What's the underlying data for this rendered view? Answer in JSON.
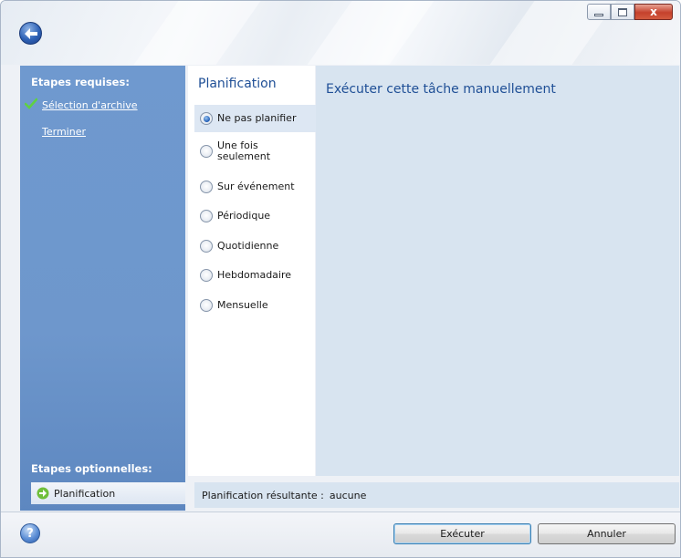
{
  "window": {
    "controls": {
      "close_label": "x"
    }
  },
  "sidebar": {
    "required_heading": "Etapes requises:",
    "required_items": [
      {
        "label": "Sélection d'archive",
        "done": true
      },
      {
        "label": "Terminer",
        "done": false
      }
    ],
    "optional_heading": "Etapes optionnelles:",
    "optional_items": [
      {
        "label": "Planification",
        "current": true
      }
    ]
  },
  "schedule": {
    "title": "Planification",
    "options": [
      {
        "label": "Ne pas planifier",
        "selected": true
      },
      {
        "label": "Une fois seulement",
        "label_line1": "Une fois",
        "label_line2": "seulement",
        "selected": false
      },
      {
        "label": "Sur événement",
        "selected": false
      },
      {
        "label": "Périodique",
        "selected": false
      },
      {
        "label": "Quotidienne",
        "selected": false
      },
      {
        "label": "Hebdomadaire",
        "selected": false
      },
      {
        "label": "Mensuelle",
        "selected": false
      }
    ]
  },
  "detail": {
    "text": "Exécuter cette tâche manuellement"
  },
  "result": {
    "label": "Planification résultante :",
    "value": "aucune"
  },
  "footer": {
    "help_label": "?",
    "execute_label": "Exécuter",
    "cancel_label": "Annuler"
  },
  "colors": {
    "sidebar": "#6e97cc",
    "panel": "#d8e4f0",
    "heading_blue": "#1f4f96"
  }
}
